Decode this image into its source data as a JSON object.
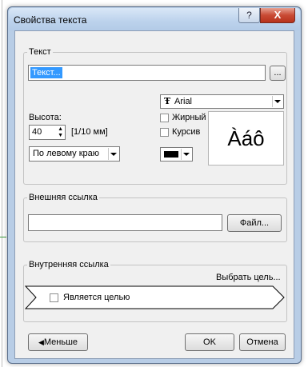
{
  "window": {
    "title": "Свойства текста",
    "help_glyph": "?",
    "close_glyph": "X"
  },
  "text_group": {
    "label": "Текст",
    "value": "Текст...",
    "browse_label": "..."
  },
  "font": {
    "icon_glyph": "Ŧ",
    "name": "Arial",
    "bold_label": "Жирный",
    "italic_label": "Курсив",
    "bold_checked": false,
    "italic_checked": false,
    "preview": "Àáô",
    "color": "#000000"
  },
  "height": {
    "label": "Высота:",
    "value": "40",
    "unit": "[1/10 мм]"
  },
  "align": {
    "value": "По левому краю"
  },
  "external_link": {
    "label": "Внешняя ссылка",
    "value": "",
    "file_button": "Файл..."
  },
  "internal_link": {
    "label": "Внутренняя ссылка",
    "select_target": "Выбрать цель...",
    "is_target_label": "Является целью",
    "is_target_checked": false
  },
  "footer": {
    "less_icon": "◀",
    "less_label": "Меньше",
    "ok_label": "OK",
    "cancel_label": "Отмена"
  }
}
